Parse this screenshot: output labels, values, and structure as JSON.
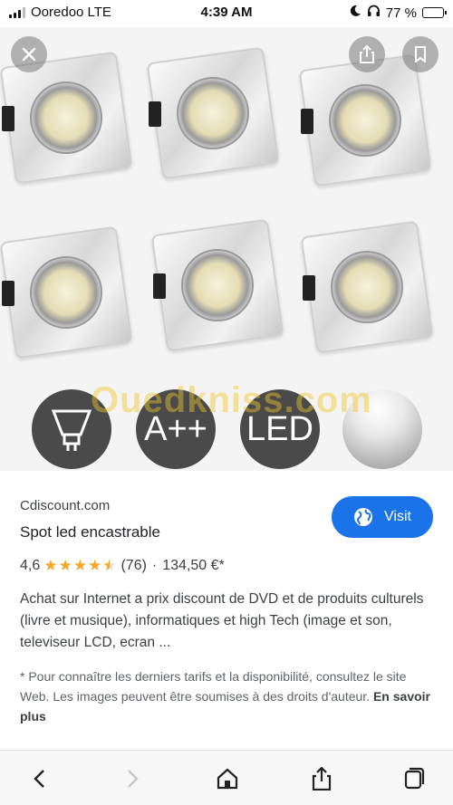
{
  "status_bar": {
    "carrier": "Ooredoo LTE",
    "time": "4:39 AM",
    "battery_text": "77 %",
    "battery_level": 0.77
  },
  "image": {
    "watermark": "Ouedkniss.com",
    "features": [
      {
        "icon": "gu10-bulb-icon",
        "label": ""
      },
      {
        "icon": "energy-class-icon",
        "label": "A++"
      },
      {
        "icon": "led-icon",
        "label": "LED"
      },
      {
        "icon": "light-sphere-icon",
        "label": ""
      }
    ]
  },
  "result": {
    "site": "Cdiscount.com",
    "title": "Spot led encastrable",
    "rating": "4,6",
    "stars_filled": 4.5,
    "reviews": "(76)",
    "separator": "·",
    "price": "134,50 €*",
    "description": "Achat sur Internet a prix discount de DVD et de produits culturels (livre et musique), informatiques et high Tech (image et son, televiseur LCD, ecran ...",
    "note": "* Pour connaître les derniers tarifs et la disponibilité, consultez le site Web. Les images peuvent être soumises à des droits d'auteur.",
    "learn_more": "En savoir plus",
    "visit_label": "Visit"
  },
  "colors": {
    "accent": "#1a73e8",
    "star": "#f5a623"
  }
}
